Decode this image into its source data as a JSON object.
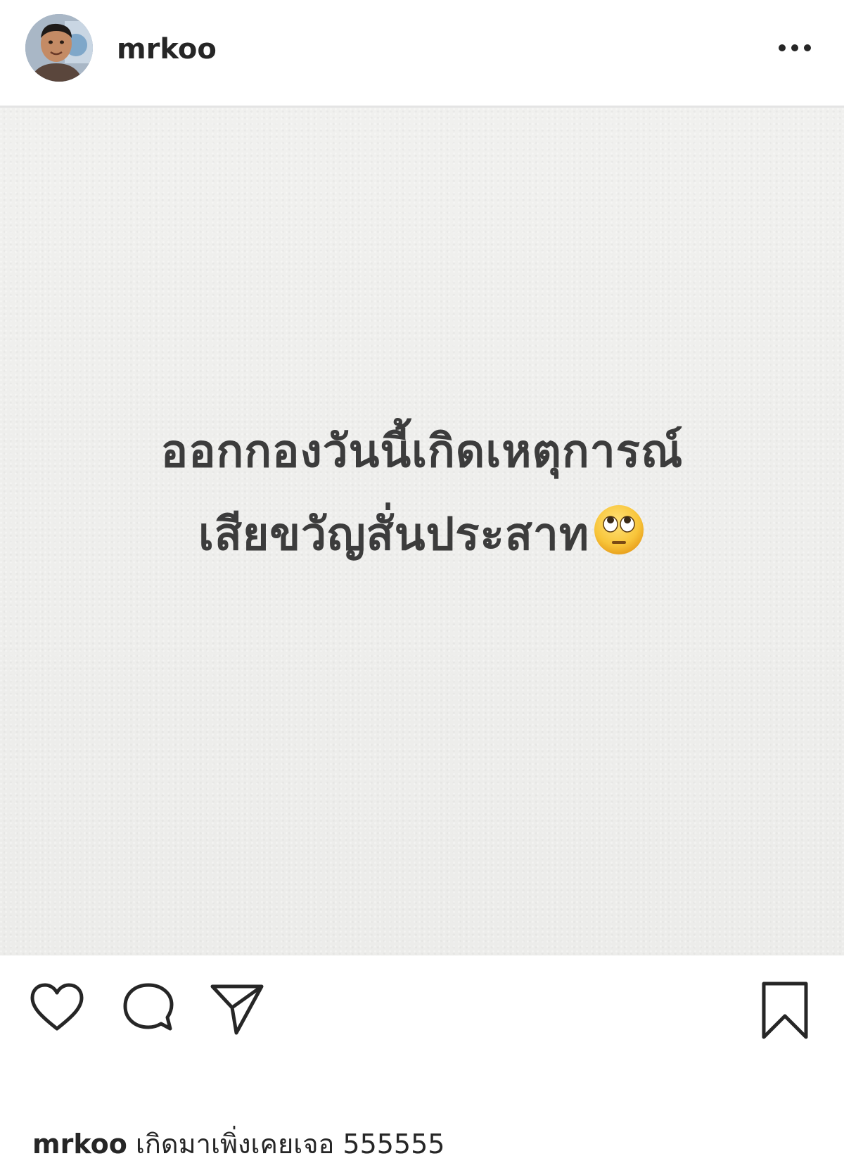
{
  "post": {
    "username": "mrkoo",
    "image_text": {
      "line1": "ออกกองวันนี้เกิดเหตุการณ์",
      "line2": "เสียขวัญสั่นประสาท",
      "emoji": "face-with-rolling-eyes"
    },
    "caption": {
      "username": "mrkoo",
      "text": "เกิดมาเพิ่งเคยเจอ 555555"
    }
  },
  "icons": {
    "more": "more-options-icon",
    "like": "heart-icon",
    "comment": "comment-icon",
    "share": "send-icon",
    "save": "bookmark-icon"
  }
}
